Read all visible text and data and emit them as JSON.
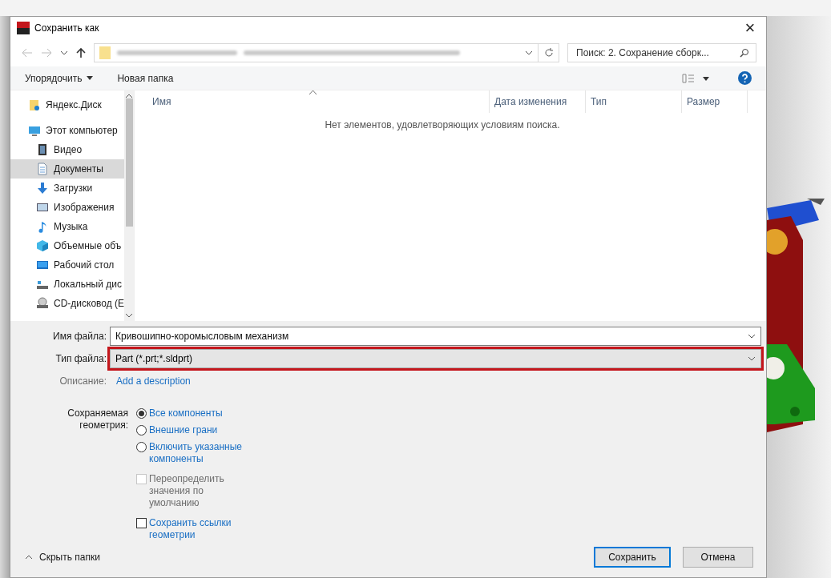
{
  "window": {
    "title": "Сохранить как",
    "close": "×"
  },
  "address_bar": {
    "search": {
      "placeholder": "Поиск: 2. Сохранение сборк..."
    }
  },
  "toolbar": {
    "organize": "Упорядочить",
    "new_folder": "Новая папка"
  },
  "sidebar": {
    "items": [
      {
        "label": "Яндекс.Диск",
        "selected": false
      },
      {
        "label": "Этот компьютер",
        "selected": false,
        "children": [
          {
            "label": "Видео",
            "selected": false
          },
          {
            "label": "Документы",
            "selected": true
          },
          {
            "label": "Загрузки",
            "selected": false
          },
          {
            "label": "Изображения",
            "selected": false
          },
          {
            "label": "Музыка",
            "selected": false
          },
          {
            "label": "Объемные объ",
            "selected": false
          },
          {
            "label": "Рабочий стол",
            "selected": false
          },
          {
            "label": "Локальный дис",
            "selected": false
          },
          {
            "label": "CD-дисковод (E",
            "selected": false
          }
        ]
      }
    ]
  },
  "table": {
    "columns": [
      "Имя",
      "Дата изменения",
      "Тип",
      "Размер"
    ],
    "empty_message": "Нет элементов, удовлетворяющих условиям поиска."
  },
  "form": {
    "file_name": {
      "label": "Имя файла:",
      "value": "Кривошипно-коромысловым механизм"
    },
    "file_type": {
      "label": "Тип файла:",
      "value": "Part (*.prt;*.sldprt)",
      "highlighted": true
    },
    "description": {
      "label": "Описание:",
      "link": "Add a description"
    },
    "geometry": {
      "label": "Сохраняемая геометрия:",
      "options": [
        {
          "label": "Все компоненты",
          "selected": true
        },
        {
          "label": "Внешние грани",
          "selected": false
        },
        {
          "label": "Включить указанные компоненты",
          "selected": false
        }
      ]
    },
    "checkboxes": [
      {
        "label": "Переопределить значения по умолчанию",
        "checked": false,
        "disabled": true
      },
      {
        "label": "Сохранить ссылки геометрии",
        "checked": false,
        "disabled": false
      }
    ]
  },
  "footer": {
    "hide_folders": "Скрыть папки",
    "buttons": [
      {
        "label": "Сохранить",
        "default": true
      },
      {
        "label": "Отмена",
        "default": false
      }
    ]
  }
}
